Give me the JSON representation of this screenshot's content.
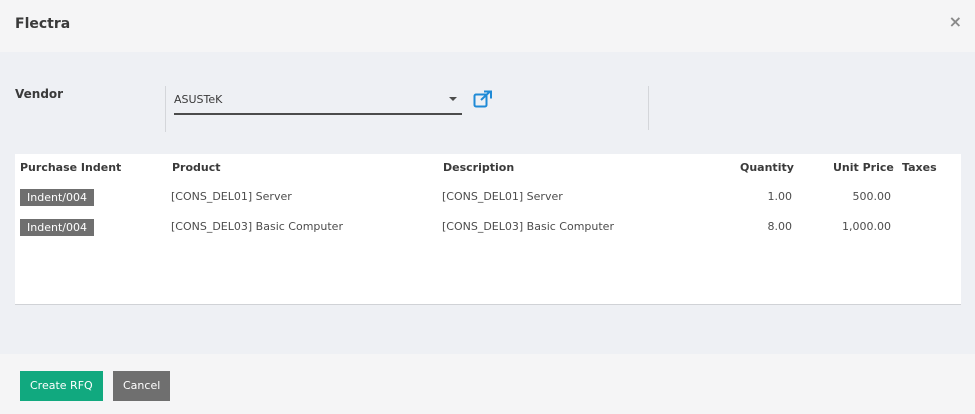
{
  "dialog": {
    "title": "Flectra",
    "close_glyph": "×"
  },
  "vendor": {
    "label": "Vendor",
    "value": "ASUSTeK"
  },
  "table": {
    "headers": [
      "Purchase Indent",
      "Product",
      "Description",
      "Quantity",
      "Unit Price",
      "Taxes"
    ],
    "rows": [
      {
        "indent": "Indent/004",
        "product": "[CONS_DEL01] Server",
        "description": "[CONS_DEL01] Server",
        "quantity": "1.00",
        "unit_price": "500.00",
        "taxes": ""
      },
      {
        "indent": "Indent/004",
        "product": "[CONS_DEL03] Basic Computer",
        "description": "[CONS_DEL03] Basic Computer",
        "quantity": "8.00",
        "unit_price": "1,000.00",
        "taxes": ""
      }
    ]
  },
  "footer": {
    "create_label": "Create RFQ",
    "cancel_label": "Cancel"
  },
  "colors": {
    "primary": "#11a97f",
    "secondary": "#6f6f6f",
    "link_icon": "#1f8ad6"
  }
}
